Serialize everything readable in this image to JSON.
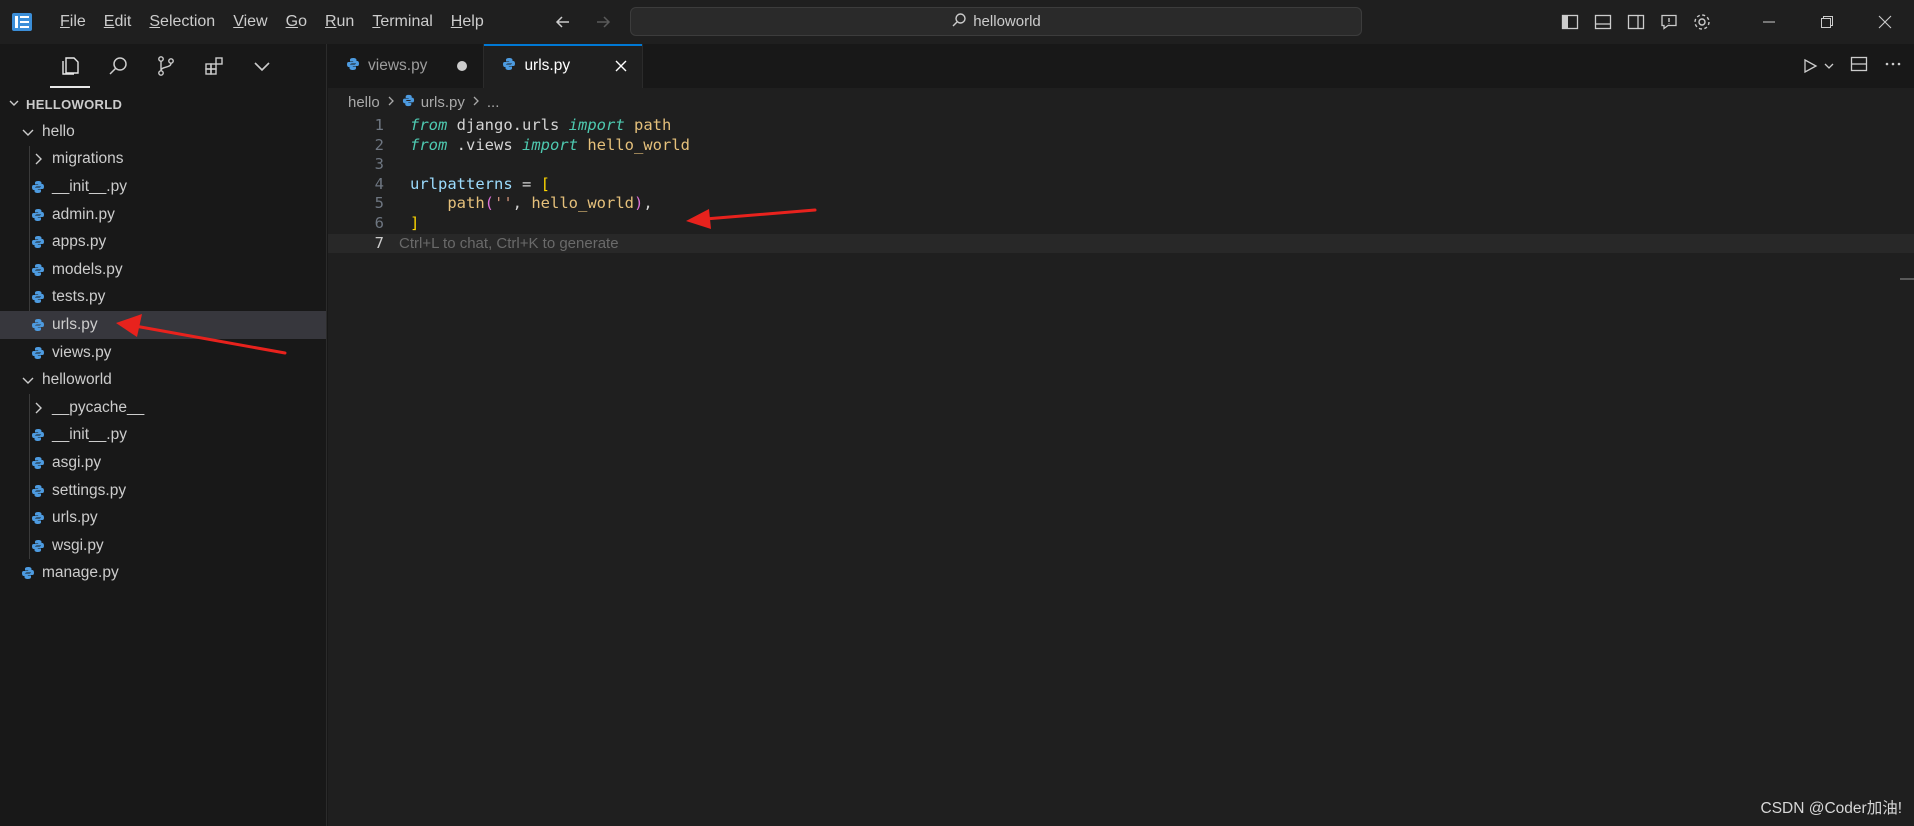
{
  "titlebar": {
    "menu": [
      {
        "mnemonic": "F",
        "rest": "ile"
      },
      {
        "mnemonic": "E",
        "rest": "dit"
      },
      {
        "mnemonic": "S",
        "rest": "election"
      },
      {
        "mnemonic": "V",
        "rest": "iew"
      },
      {
        "mnemonic": "G",
        "rest": "o"
      },
      {
        "mnemonic": "R",
        "rest": "un"
      },
      {
        "mnemonic": "T",
        "rest": "erminal"
      },
      {
        "mnemonic": "H",
        "rest": "elp"
      }
    ],
    "search_text": "helloworld"
  },
  "explorer": {
    "title": "HELLOWORLD",
    "items": [
      {
        "label": "hello",
        "type": "folder-open"
      },
      {
        "label": "migrations",
        "type": "folder-closed"
      },
      {
        "label": "__init__.py",
        "type": "py"
      },
      {
        "label": "admin.py",
        "type": "py"
      },
      {
        "label": "apps.py",
        "type": "py"
      },
      {
        "label": "models.py",
        "type": "py"
      },
      {
        "label": "tests.py",
        "type": "py"
      },
      {
        "label": "urls.py",
        "type": "py"
      },
      {
        "label": "views.py",
        "type": "py"
      },
      {
        "label": "helloworld",
        "type": "folder-open"
      },
      {
        "label": "__pycache__",
        "type": "folder-closed"
      },
      {
        "label": "__init__.py",
        "type": "py"
      },
      {
        "label": "asgi.py",
        "type": "py"
      },
      {
        "label": "settings.py",
        "type": "py"
      },
      {
        "label": "urls.py",
        "type": "py"
      },
      {
        "label": "wsgi.py",
        "type": "py"
      },
      {
        "label": "manage.py",
        "type": "py"
      }
    ]
  },
  "tabs": [
    {
      "label": "views.py",
      "modified": true
    },
    {
      "label": "urls.py",
      "active": true
    }
  ],
  "breadcrumb": {
    "folder": "hello",
    "file": "urls.py",
    "more": "..."
  },
  "code": {
    "line_numbers": [
      "1",
      "2",
      "3",
      "4",
      "5",
      "6",
      "7"
    ],
    "l1": {
      "kw1": "from",
      "mod": " django.urls ",
      "kw2": "import",
      "name": " path"
    },
    "l2": {
      "kw1": "from",
      "mod": " .views ",
      "kw2": "import",
      "name": " hello_world"
    },
    "l4": {
      "var": "urlpatterns",
      "op": " = ",
      "br": "["
    },
    "l5": {
      "indent": "    ",
      "fn": "path",
      "open": "(",
      "str": "''",
      "sep": ", ",
      "arg": "hello_world",
      "close": ")",
      "end": ","
    },
    "l6": {
      "br": "]"
    },
    "hint": "Ctrl+L to chat, Ctrl+K to generate"
  },
  "watermark": "CSDN @Coder加油!",
  "colors": {
    "accent": "#0078d4",
    "arrow": "#e8221d",
    "python_icon": "#4d9be0"
  }
}
